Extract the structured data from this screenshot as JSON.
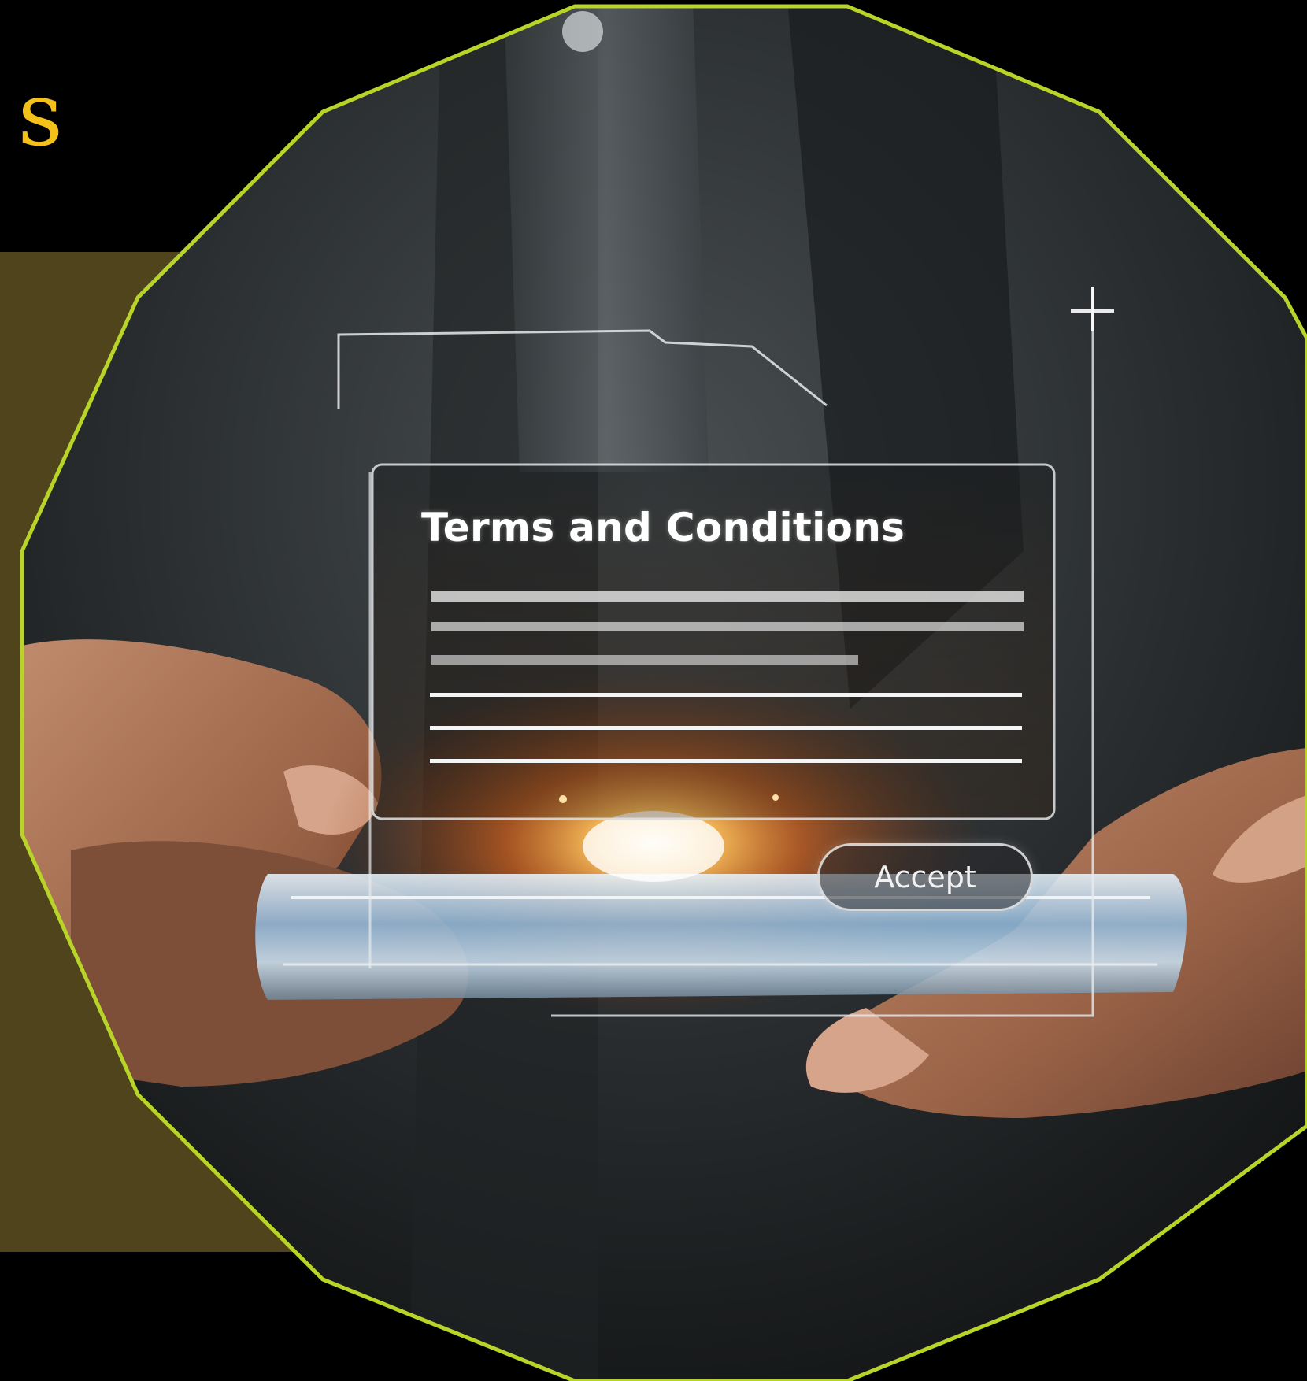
{
  "heading": {
    "fragment": "s",
    "color": "#f4c01a"
  },
  "colors": {
    "background": "#000000",
    "panel": "#4f441b",
    "frame_outline": "#b8d428"
  },
  "photo": {
    "hologram": {
      "title": "Terms and Conditions",
      "accept_label": "Accept"
    }
  }
}
